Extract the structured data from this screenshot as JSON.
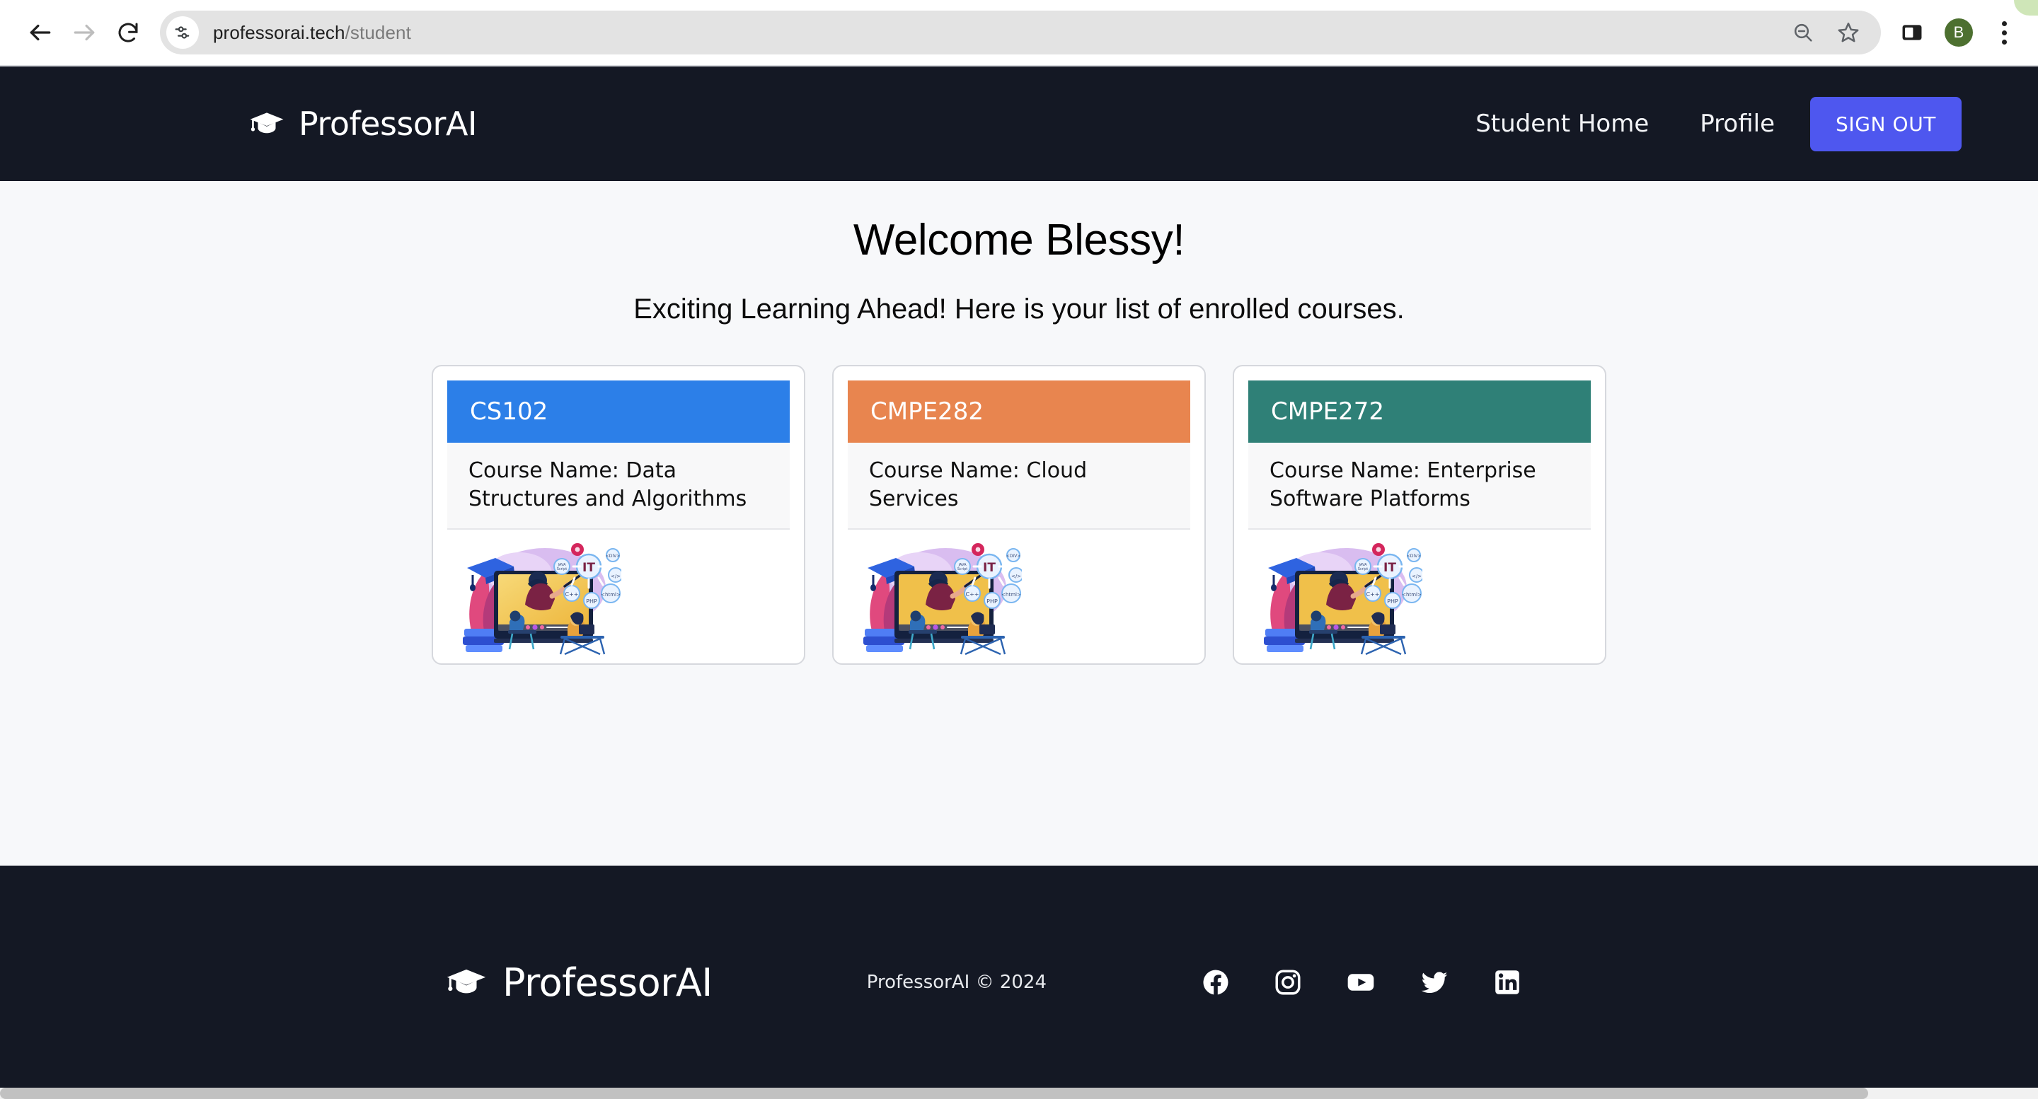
{
  "browser": {
    "back_icon": "back-arrow-icon",
    "forward_icon": "forward-arrow-icon",
    "reload_icon": "reload-icon",
    "site_settings_icon": "tune-sliders-icon",
    "url_domain": "professorai.tech",
    "url_path": "/student",
    "zoom_out_icon": "zoom-out-magnifier-icon",
    "bookmark_icon": "bookmark-star-icon",
    "side_panel_icon": "side-panel-icon",
    "avatar_letter": "B",
    "menu_icon": "three-dot-menu-icon"
  },
  "header": {
    "logo_icon": "graduation-cap-icon",
    "brand": "ProfessorAI",
    "nav": [
      {
        "label": "Student Home"
      },
      {
        "label": "Profile"
      }
    ],
    "signout_label": "SIGN OUT",
    "signout_color": "#4e57ef",
    "background": "#141824"
  },
  "main": {
    "title": "Welcome Blessy!",
    "subtitle": "Exciting Learning Ahead! Here is your list of enrolled courses.",
    "background": "#f7f8fa",
    "courses": [
      {
        "code": "CS102",
        "course_name": "Course Name: Data Structures and Algorithms",
        "header_color": "#2c7fe8",
        "illustration": "it-online-learning-illustration"
      },
      {
        "code": "CMPE282",
        "course_name": "Course Name: Cloud Services",
        "header_color": "#e8854f",
        "illustration": "it-online-learning-illustration"
      },
      {
        "code": "CMPE272",
        "course_name": "Course Name: Enterprise Software Platforms",
        "header_color": "#2f8077",
        "illustration": "it-online-learning-illustration"
      }
    ]
  },
  "footer": {
    "logo_icon": "graduation-cap-icon",
    "brand": "ProfessorAI",
    "copyright": "ProfessorAI © 2024",
    "socials": [
      {
        "name": "facebook-icon"
      },
      {
        "name": "instagram-icon"
      },
      {
        "name": "youtube-icon"
      },
      {
        "name": "twitter-icon"
      },
      {
        "name": "linkedin-icon"
      }
    ],
    "background": "#141824"
  }
}
